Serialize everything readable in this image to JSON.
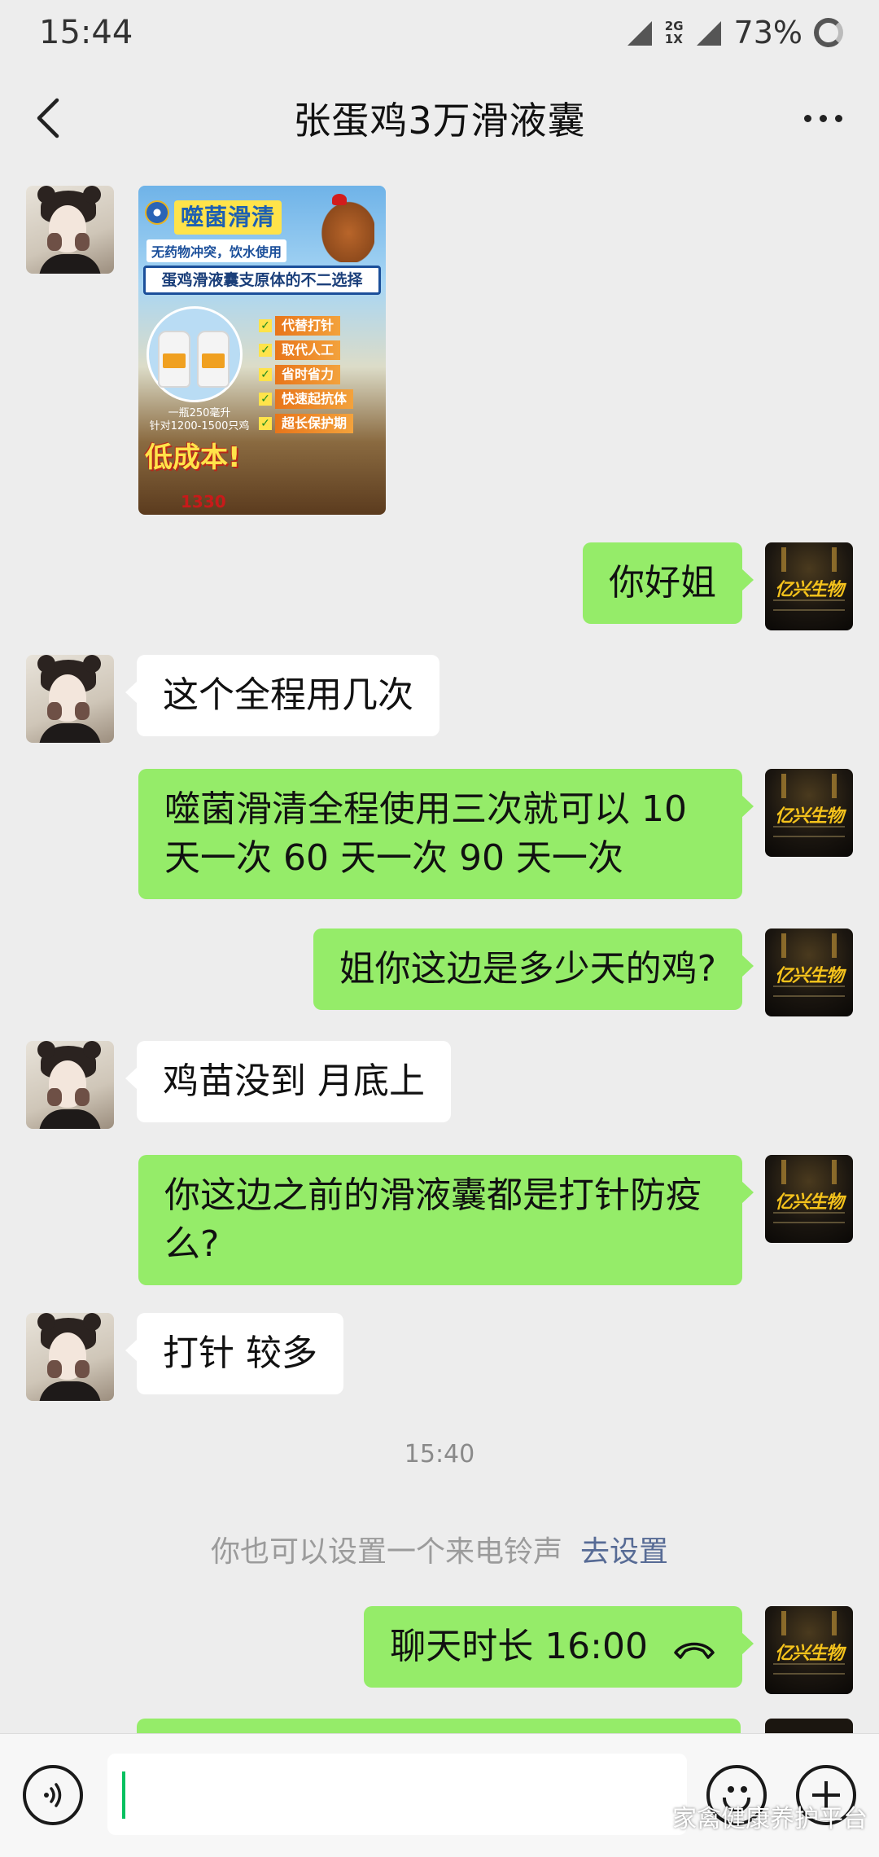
{
  "status_bar": {
    "time": "15:44",
    "net_top": "2G",
    "net_bottom": "1X",
    "battery": "73%"
  },
  "header": {
    "title": "张蛋鸡3万滑液囊"
  },
  "poster": {
    "title": "噬菌滑清",
    "note": "无药物冲突，饮水使用",
    "banner": "蛋鸡滑液囊支原体的不二选择",
    "features": [
      "代替打针",
      "取代人工",
      "省时省力",
      "快速起抗体",
      "超长保护期"
    ],
    "dose_line1": "一瓶250毫升",
    "dose_line2": "针对1200-1500只鸡",
    "slogan": "低成本!",
    "phone": "1330",
    "colors": {
      "title_bg": "#ffe34a",
      "tag": "#e8751a",
      "phone": "#c81a1a"
    }
  },
  "messages": [
    {
      "side": "right",
      "text": "你好姐"
    },
    {
      "side": "left",
      "text": "这个全程用几次"
    },
    {
      "side": "right",
      "line1": "噬菌滑清全程使用三次就可以  10",
      "line2": "天一次   60 天一次 90 天一次"
    },
    {
      "side": "right",
      "text": "姐你这边是多少天的鸡?"
    },
    {
      "side": "left",
      "text": "鸡苗没到   月底上"
    },
    {
      "side": "right",
      "line1": "你这边之前的滑液囊都是打针防疫",
      "line2": "么?"
    },
    {
      "side": "left",
      "text": "打针 较多"
    },
    {
      "side": "right",
      "text": "聊天时长 16:00"
    }
  ],
  "timestamp": "15:40",
  "system": {
    "text": "你也可以设置一个来电铃声",
    "link": "去设置"
  },
  "avatars": {
    "right_logo": "亿兴生物"
  },
  "input": {
    "placeholder": ""
  },
  "watermark": "家禽健康养护平台",
  "theme": {
    "bubble_green": "#95ec69",
    "bubble_white": "#ffffff",
    "background": "#ededed",
    "link": "#576b95",
    "cursor": "#07c160"
  }
}
